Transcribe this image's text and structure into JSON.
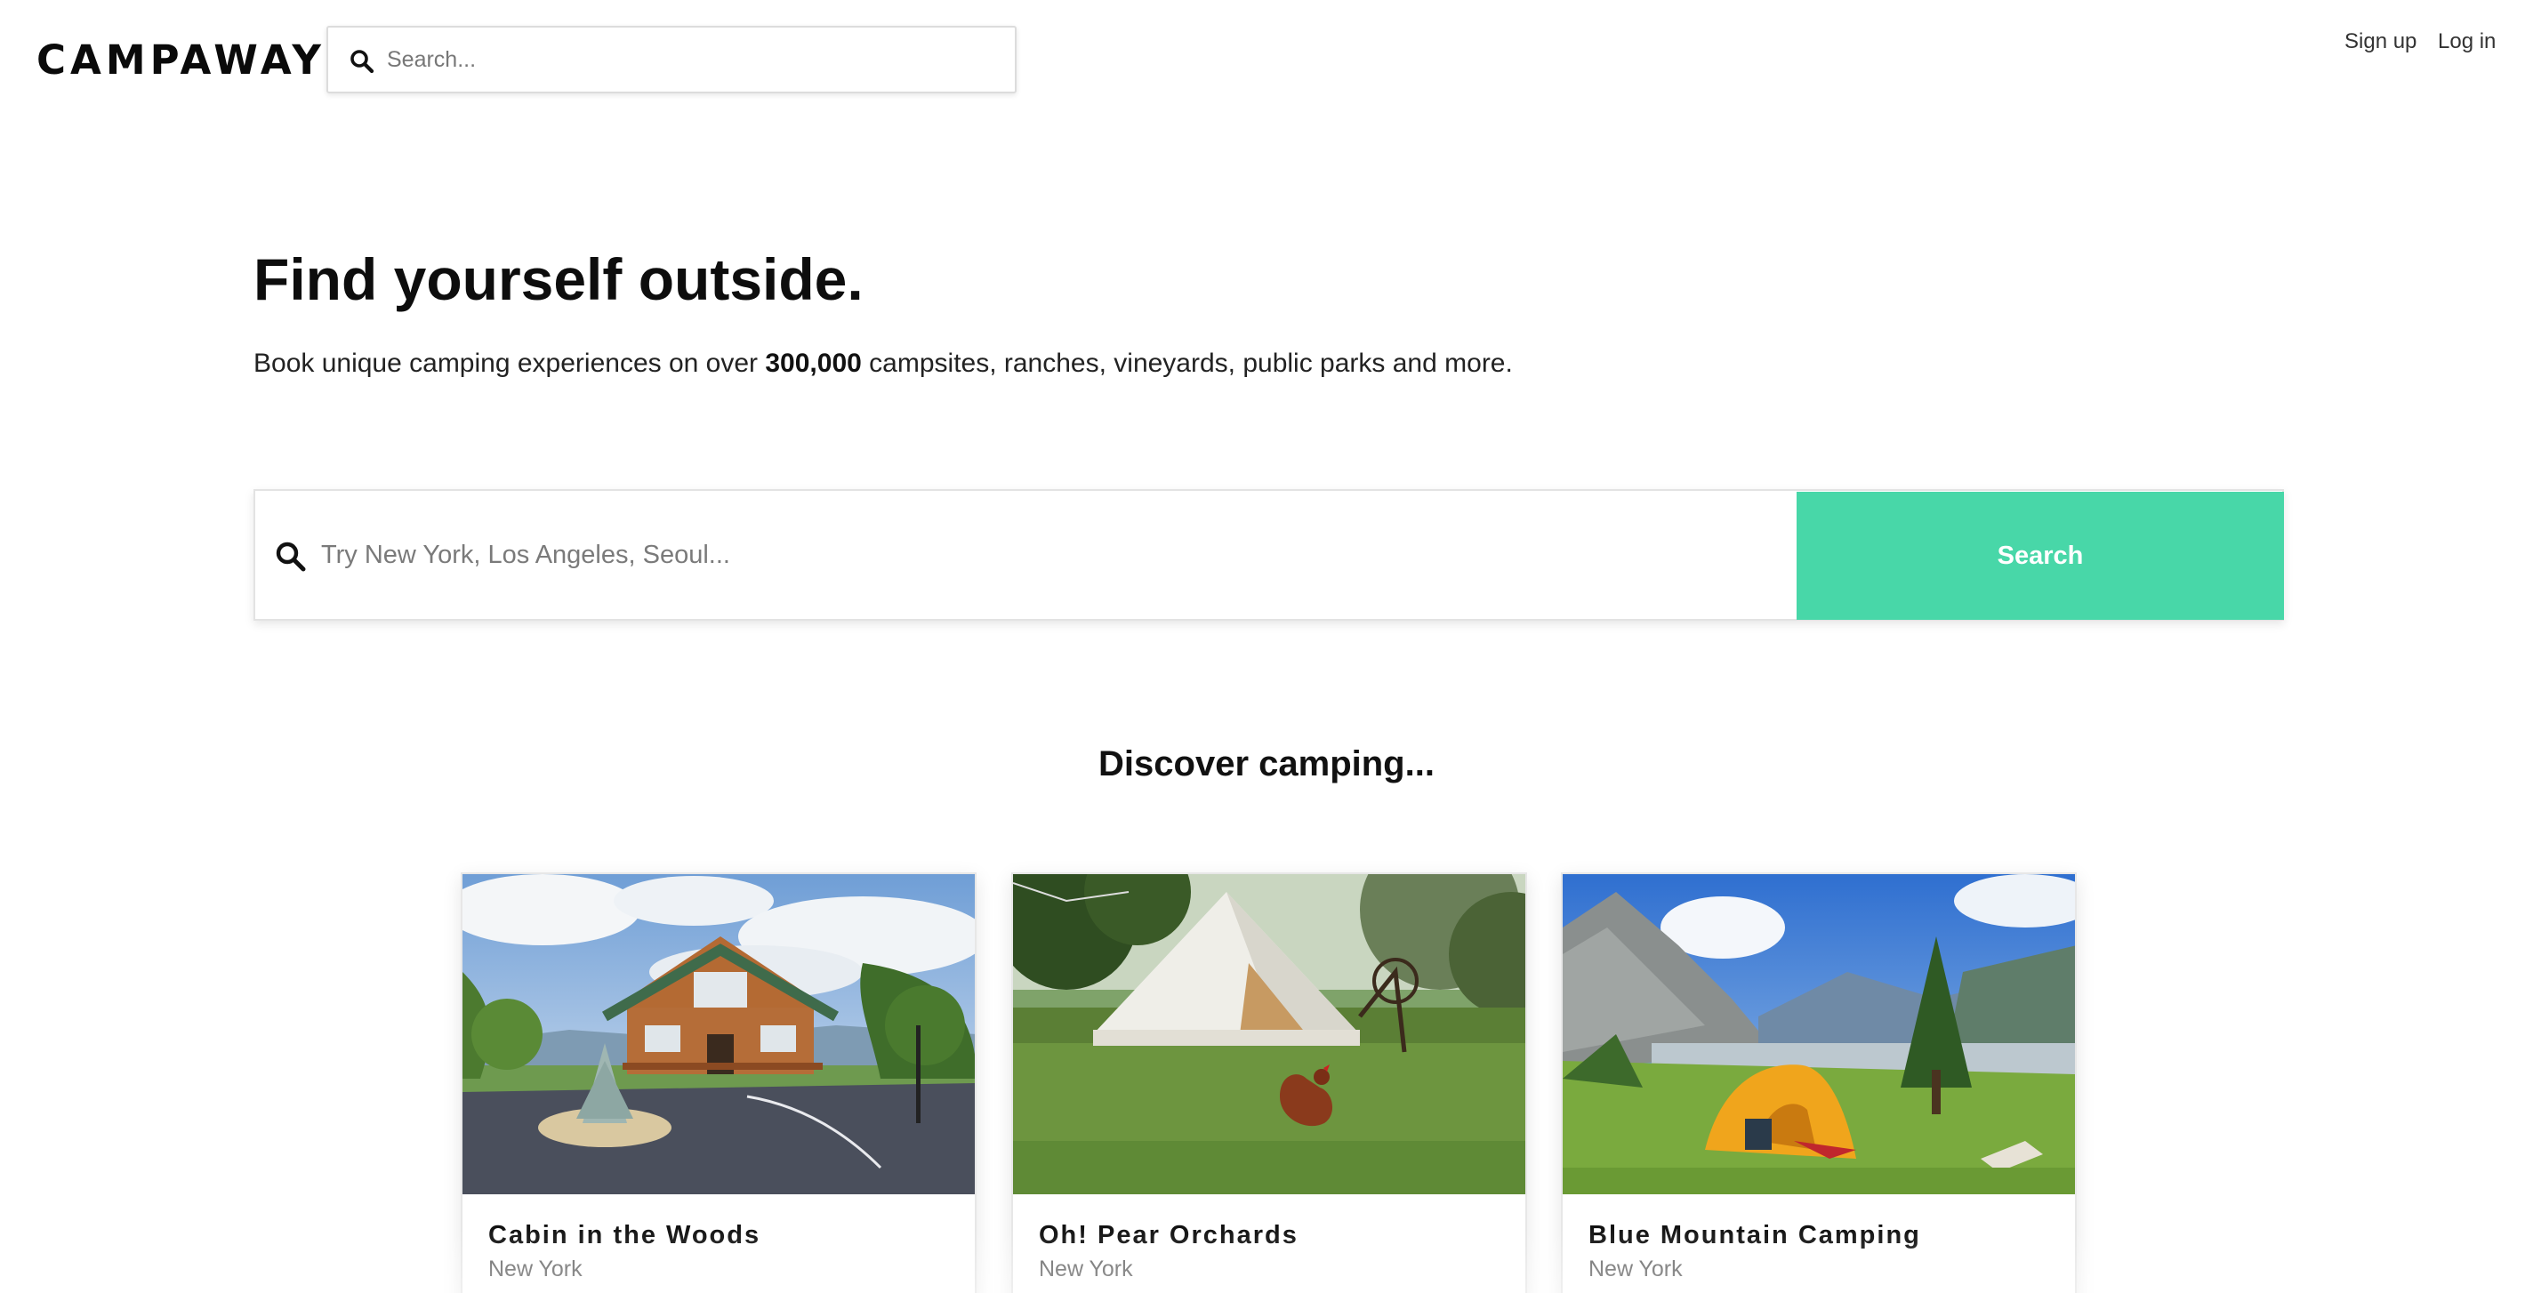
{
  "header": {
    "logo": "CAMPAWAY",
    "search_placeholder": "Search...",
    "nav": {
      "signup": "Sign up",
      "login": "Log in"
    }
  },
  "hero": {
    "title": "Find yourself outside.",
    "subtitle_before": "Book unique camping experiences on over ",
    "subtitle_bold": "300,000",
    "subtitle_after": " campsites, ranches, vineyards, public parks and more."
  },
  "main_search": {
    "placeholder": "Try New York, Los Angeles, Seoul...",
    "button_label": "Search"
  },
  "discover": {
    "title": "Discover camping...",
    "cards": [
      {
        "title": "Cabin in the Woods",
        "location": "New York"
      },
      {
        "title": "Oh! Pear Orchards",
        "location": "New York"
      },
      {
        "title": "Blue Mountain Camping",
        "location": "New York"
      }
    ]
  },
  "colors": {
    "accent": "#48d7a8",
    "text": "#111111",
    "muted": "#666666"
  },
  "icons": {
    "top_search": "search-icon",
    "main_search": "search-icon"
  }
}
